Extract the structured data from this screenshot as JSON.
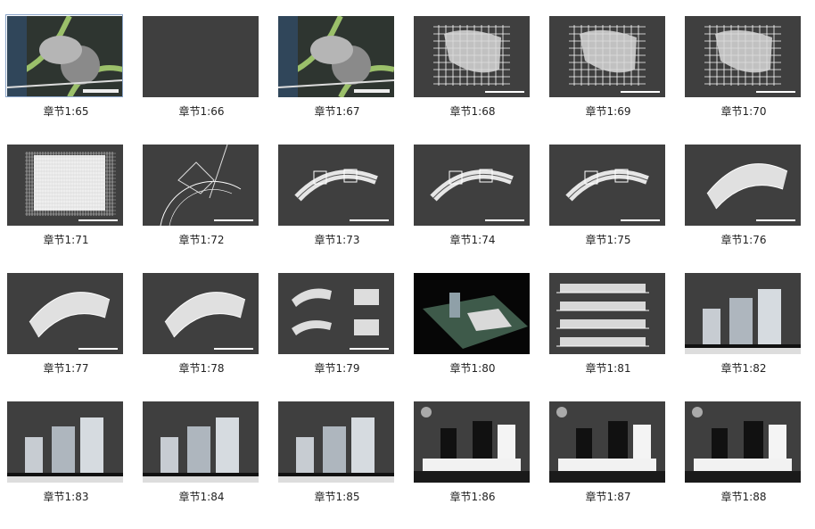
{
  "thumbnails": [
    {
      "label": "章节1:65",
      "kind": "aerial"
    },
    {
      "label": "章节1:66",
      "kind": "blank"
    },
    {
      "label": "章节1:67",
      "kind": "aerial"
    },
    {
      "label": "章节1:68",
      "kind": "grid-plan"
    },
    {
      "label": "章节1:69",
      "kind": "grid-plan"
    },
    {
      "label": "章节1:70",
      "kind": "grid-plan"
    },
    {
      "label": "章节1:71",
      "kind": "dense-grid"
    },
    {
      "label": "章节1:72",
      "kind": "arc-plan"
    },
    {
      "label": "章节1:73",
      "kind": "curve-plan"
    },
    {
      "label": "章节1:74",
      "kind": "curve-plan"
    },
    {
      "label": "章节1:75",
      "kind": "curve-plan"
    },
    {
      "label": "章节1:76",
      "kind": "fan-plan"
    },
    {
      "label": "章节1:77",
      "kind": "fan-plan"
    },
    {
      "label": "章节1:78",
      "kind": "fan-plan"
    },
    {
      "label": "章节1:79",
      "kind": "multi-plan"
    },
    {
      "label": "章节1:80",
      "kind": "render3d"
    },
    {
      "label": "章节1:81",
      "kind": "elevations"
    },
    {
      "label": "章节1:82",
      "kind": "towers"
    },
    {
      "label": "章节1:83",
      "kind": "towers"
    },
    {
      "label": "章节1:84",
      "kind": "towers"
    },
    {
      "label": "章节1:85",
      "kind": "towers"
    },
    {
      "label": "章节1:86",
      "kind": "section-white"
    },
    {
      "label": "章节1:87",
      "kind": "section-white"
    },
    {
      "label": "章节1:88",
      "kind": "section-white"
    }
  ],
  "selected_index": 0
}
